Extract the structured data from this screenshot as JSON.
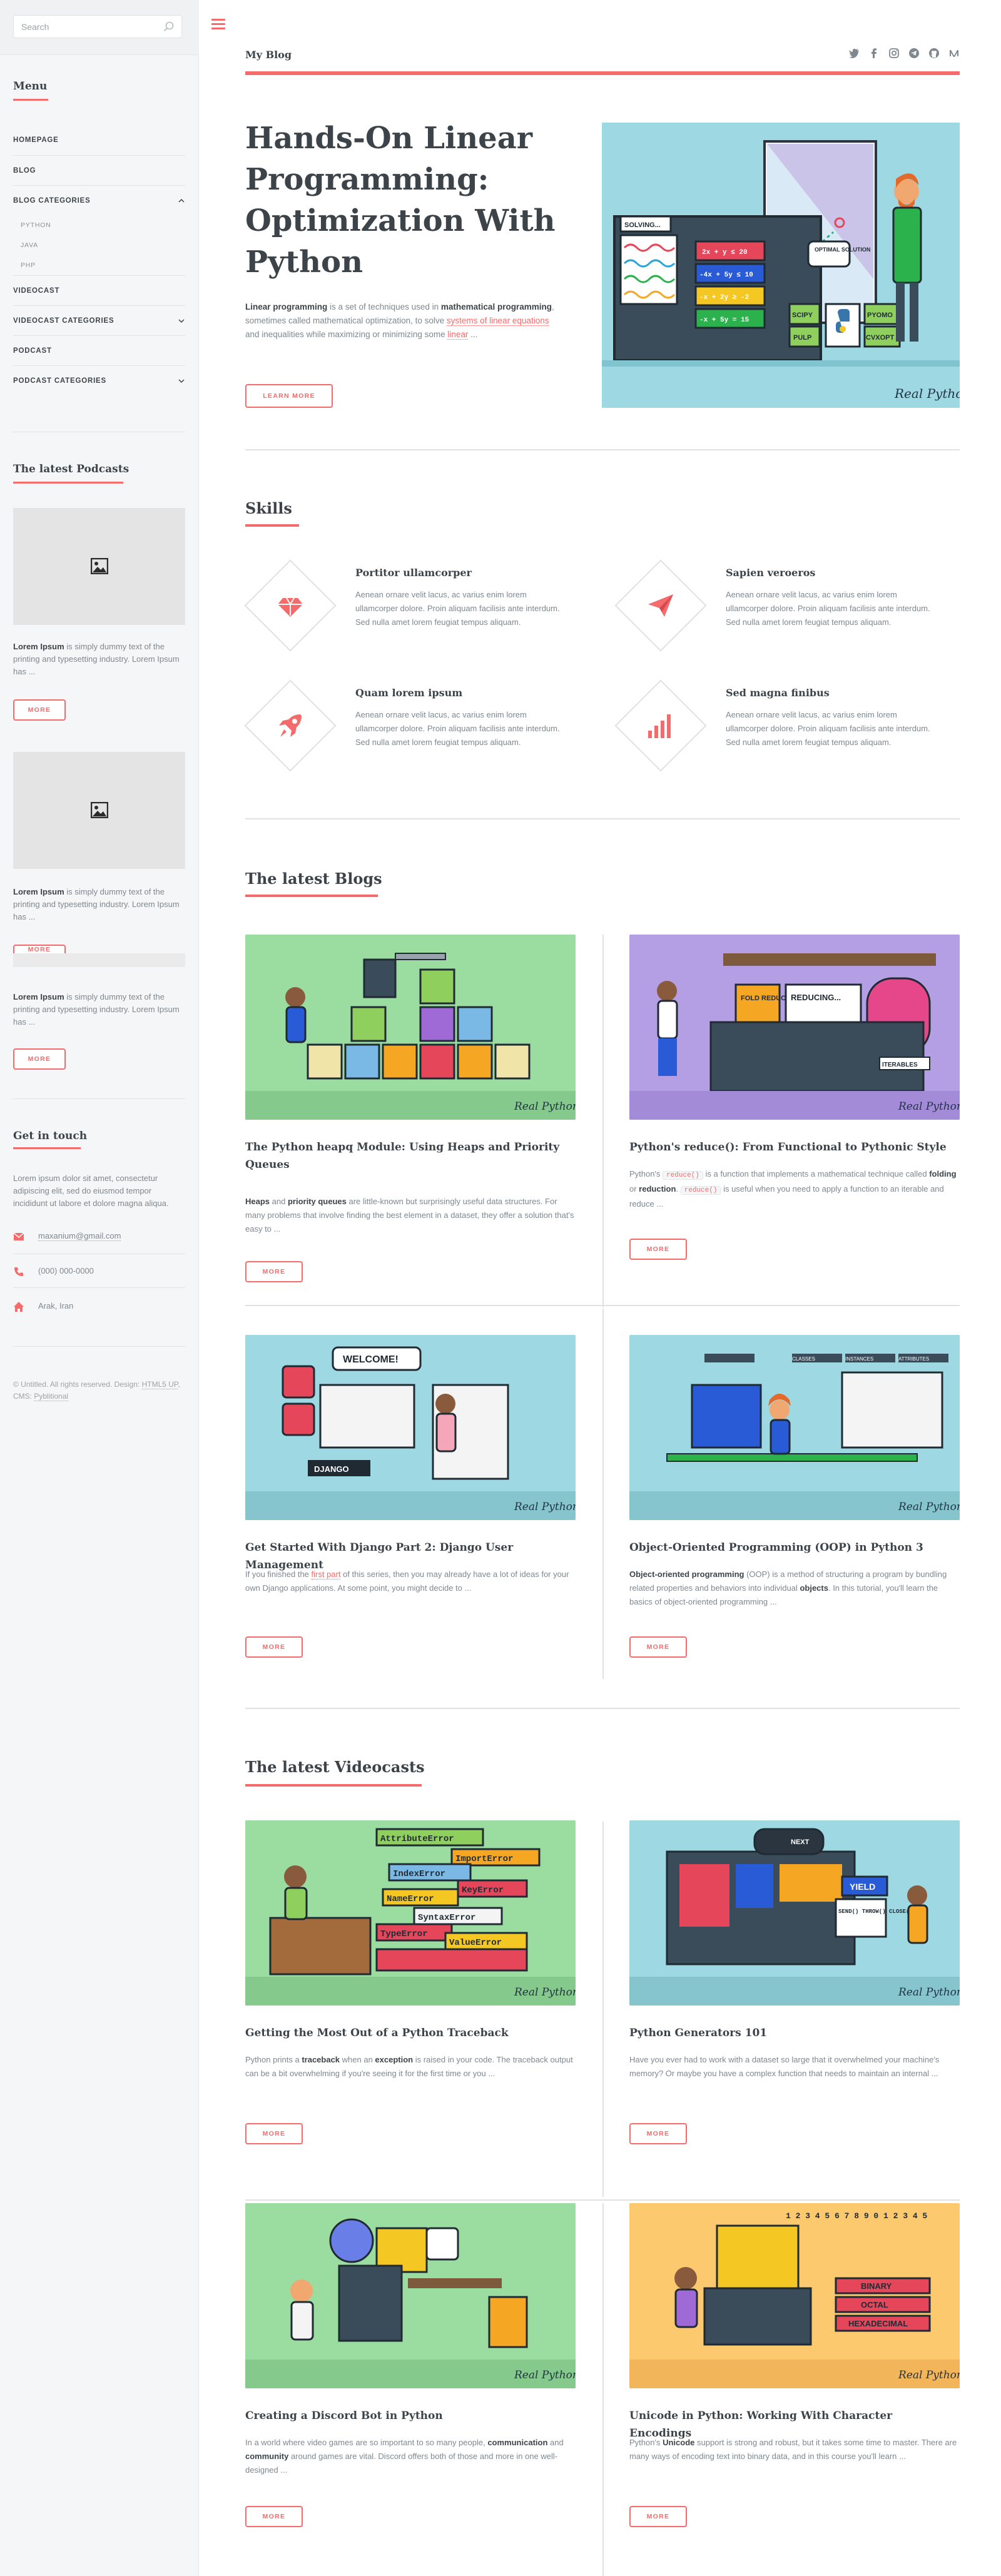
{
  "sidebar": {
    "search": {
      "placeholder": "Search"
    },
    "menu_title": "Menu",
    "nav": [
      {
        "label": "Homepage"
      },
      {
        "label": "Blog"
      },
      {
        "label": "Blog Categories",
        "expanded": true,
        "children": [
          "Python",
          "Java",
          "PHP"
        ]
      },
      {
        "label": "Videocast"
      },
      {
        "label": "Videocast Categories"
      },
      {
        "label": "Podcast"
      },
      {
        "label": "Podcast Categories"
      }
    ],
    "podcasts_title": "The latest Podcasts",
    "podcasts": [
      {
        "lead": "Lorem Ipsum",
        "text": " is simply dummy text of the printing and typesetting industry. Lorem Ipsum has ...",
        "button": "More"
      },
      {
        "lead": "Lorem Ipsum",
        "text": " is simply dummy text of the printing and typesetting industry. Lorem Ipsum has ...",
        "button": "More"
      },
      {
        "lead": "Lorem Ipsum",
        "text": " is simply dummy text of the printing and typesetting industry. Lorem Ipsum has ...",
        "button": "More"
      }
    ],
    "contact_title": "Get in touch",
    "contact_text": "Lorem ipsum dolor sit amet, consectetur adipiscing elit, sed do eiusmod tempor incididunt ut labore et dolore magna aliqua.",
    "email": "maxanium@gmail.com",
    "phone": "(000) 000-0000",
    "address": "Arak, Iran",
    "copyright_prefix": "© Untitled. All rights reserved. Design: ",
    "copyright_design": "HTML5 UP",
    "copyright_mid": ", CMS: ",
    "copyright_cms": "Pyblitional"
  },
  "header": {
    "logo": "My Blog",
    "social_icons": [
      "twitter-icon",
      "facebook-icon",
      "instagram-icon",
      "telegram-icon",
      "github-icon",
      "medium-icon"
    ]
  },
  "hero": {
    "title": "Hands-On Linear Programming: Optimization With Python",
    "text_lead": "Linear programming",
    "text_1": " is a set of techniques used in ",
    "text_bold2": "mathematical programming",
    "text_2": ", sometimes called mathematical optimization, to solve ",
    "text_link": "systems of linear equations",
    "text_3": " and inequalities while maximizing or minimizing some ",
    "text_link2": "linear",
    "text_4": " ...",
    "button": "Learn more",
    "image_caption": "Real Python"
  },
  "skills": {
    "title": "Skills",
    "items": [
      {
        "icon": "diamond-icon",
        "title": "Portitor ullamcorper",
        "text": "Aenean ornare velit lacus, ac varius enim lorem ullamcorper dolore. Proin aliquam facilisis ante interdum. Sed nulla amet lorem feugiat tempus aliquam."
      },
      {
        "icon": "paper-plane-icon",
        "title": "Sapien veroeros",
        "text": "Aenean ornare velit lacus, ac varius enim lorem ullamcorper dolore. Proin aliquam facilisis ante interdum. Sed nulla amet lorem feugiat tempus aliquam."
      },
      {
        "icon": "rocket-icon",
        "title": "Quam lorem ipsum",
        "text": "Aenean ornare velit lacus, ac varius enim lorem ullamcorper dolore. Proin aliquam facilisis ante interdum. Sed nulla amet lorem feugiat tempus aliquam."
      },
      {
        "icon": "signal-icon",
        "title": "Sed magna finibus",
        "text": "Aenean ornare velit lacus, ac varius enim lorem ullamcorper dolore. Proin aliquam facilisis ante interdum. Sed nulla amet lorem feugiat tempus aliquam."
      }
    ]
  },
  "blogs": {
    "title": "The latest Blogs",
    "posts": [
      {
        "title": "The Python heapq Module: Using Heaps and Priority Queues",
        "button": "More",
        "bg": "#9bdca0"
      },
      {
        "title": "Python's reduce(): From Functional to Pythonic Style",
        "button": "More",
        "bg": "#b49ee4"
      },
      {
        "title": "Get Started With Django Part 2: Django User Management",
        "button": "More",
        "bg": "#9ed8e2"
      },
      {
        "title": "Object-Oriented Programming (OOP) in Python 3",
        "button": "More",
        "bg": "#9ed8e2"
      }
    ],
    "p1_b1": "Heaps",
    "p1_t1": " and ",
    "p1_b2": "priority queues",
    "p1_t2": " are little-known but surprisingly useful data structures. For many problems that involve finding the best element in a dataset, they offer a solution that's easy to ...",
    "p2_t1": "Python's ",
    "p2_c1": "reduce()",
    "p2_t2": " is a function that implements a mathematical technique called ",
    "p2_b1": "folding",
    "p2_t3": " or ",
    "p2_b2": "reduction",
    "p2_t4": ". ",
    "p2_c2": "reduce()",
    "p2_t5": " is useful when you need to apply a function to an iterable and reduce ...",
    "p3_t1": "If you finished the ",
    "p3_a1": "first part",
    "p3_t2": " of this series, then you may already have a lot of ideas for your own Django applications. At some point, you might decide to ...",
    "p4_b1": "Object-oriented programming",
    "p4_t1": " (OOP) is a method of structuring a program by bundling related properties and behaviors into individual ",
    "p4_b2": "objects",
    "p4_t2": ". In this tutorial, you'll learn the basics of object-oriented programming ..."
  },
  "videocasts": {
    "title": "The latest Videocasts",
    "posts": [
      {
        "title": "Getting the Most Out of a Python Traceback",
        "button": "More",
        "bg": "#9bdca0"
      },
      {
        "title": "Python Generators 101",
        "button": "More",
        "bg": "#9ed8e2"
      },
      {
        "title": "Creating a Discord Bot in Python",
        "button": "More",
        "bg": "#9bdca0"
      },
      {
        "title": "Unicode in Python: Working With Character Encodings",
        "button": "More",
        "bg": "#fcc96e"
      }
    ],
    "v1_t1": "Python prints a ",
    "v1_b1": "traceback",
    "v1_t2": " when an ",
    "v1_b2": "exception",
    "v1_t3": " is raised in your code. The traceback output can be a bit overwhelming if you're seeing it for the first time or you ...",
    "v2_t1": "Have you ever had to work with a dataset so large that it overwhelmed your machine's memory? Or maybe you have a complex function that needs to maintain an internal ...",
    "v3_t1": "In a world where video games are so important to so many people, ",
    "v3_b1": "communication",
    "v3_t2": " and ",
    "v3_b2": "community",
    "v3_t3": " around games are vital. Discord offers both of those and more in one well-designed ...",
    "v4_t1": "Python's ",
    "v4_b1": "Unicode",
    "v4_t2": " support is strong and robust, but it takes some time to master. There are many ways of encoding text into binary data, and in this course you'll learn ..."
  },
  "image_text": {
    "signature": "Real Python",
    "hero_solving": "SOLVING...",
    "hero_solution": "OPTIMAL SOLUTION",
    "hero_eq1": "2x + y ≤ 20",
    "hero_eq2": "-4x + 5y ≤ 10",
    "hero_eq3": "-x + 2y ≥ -2",
    "hero_eq4": "-x + 5y = 15",
    "hero_scipy": "SCIPY",
    "hero_pulp": "PULP",
    "hero_pyomo": "PYOMO",
    "hero_cvxopt": "CVXOPT",
    "reduce_fold": "FOLD REDUCE",
    "reduce_reducing": "REDUCING...",
    "reduce_iterables": "ITERABLES",
    "django_welcome": "WELCOME!",
    "django_label": "DJANGO",
    "tb_errors": [
      "AttributeError",
      "ImportError",
      "IndexError",
      "KeyError",
      "NameError",
      "SyntaxError",
      "TypeError",
      "ValueError"
    ],
    "gen_yield": "YIELD",
    "gen_methods": "SEND() THROW() CLOSE()",
    "gen_next": "NEXT",
    "uni_binary": "BINARY",
    "uni_octal": "OCTAL",
    "uni_hex": "HEXADECIMAL",
    "uni_digits": "1 2 3 4 5 6 7 8 9 0 1 2 3 4 5",
    "oop_labels": [
      "CLASSES",
      "INSTANCES",
      "ATTRIBUTES"
    ]
  },
  "colors": {
    "accent": "#f56a6a",
    "text": "#3d4449",
    "muted": "#7f888f",
    "sidebar_bg": "#f5f6f7"
  }
}
